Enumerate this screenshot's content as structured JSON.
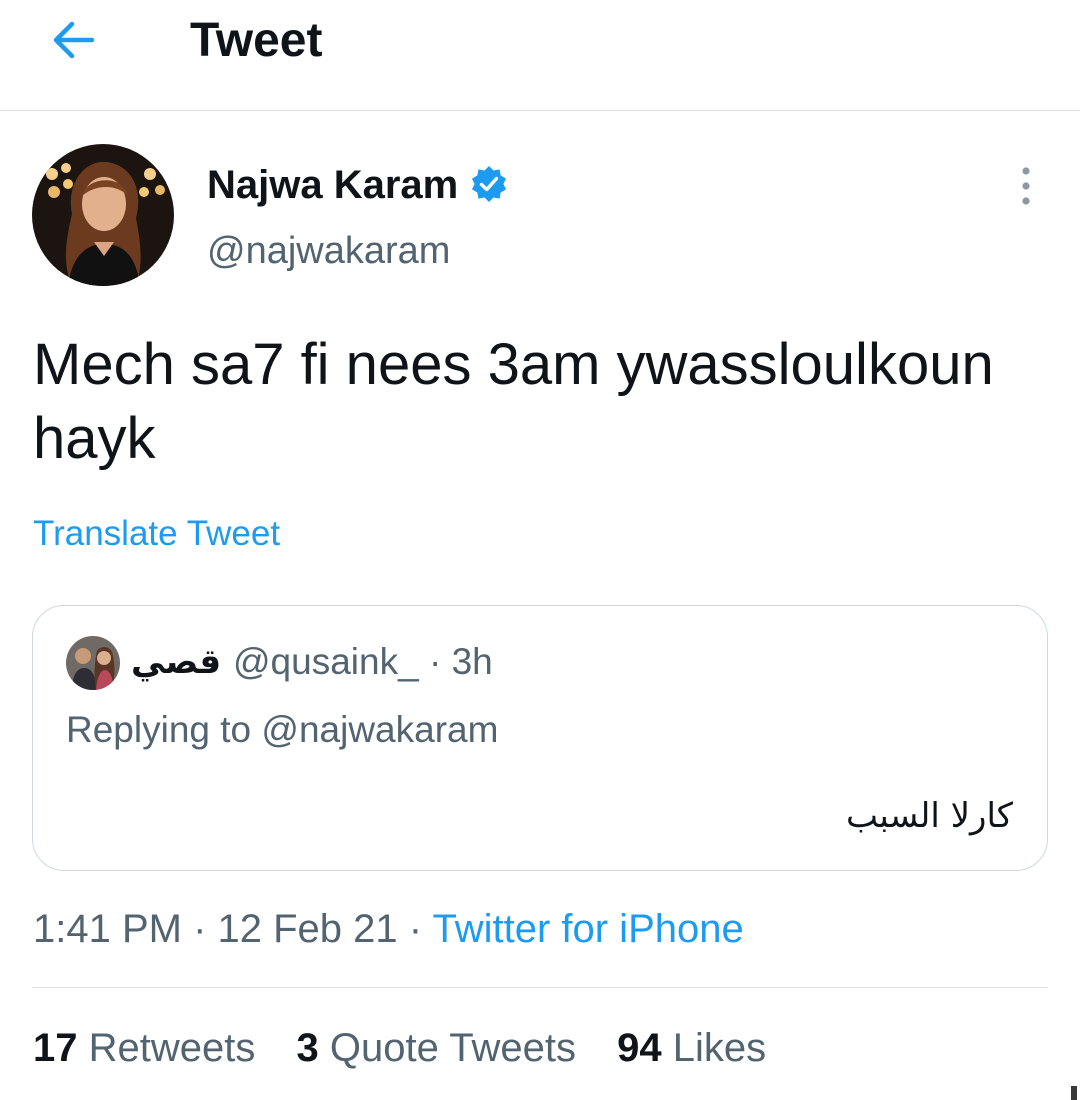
{
  "header": {
    "title": "Tweet",
    "back_icon": "arrow-left-icon"
  },
  "author": {
    "name": "Najwa Karam",
    "handle": "@najwakaram",
    "verified": true,
    "verified_color": "#1d9bf0"
  },
  "tweet": {
    "text": "Mech sa7 fi nees 3am ywassloulkoun hayk",
    "translate_label": "Translate Tweet"
  },
  "quoted": {
    "name": "قصي",
    "handle": "@qusaink_",
    "separator": "·",
    "time": "3h",
    "replying_label": "Replying to @najwakaram",
    "text": "كارلا السبب"
  },
  "meta": {
    "time": "1:41 PM",
    "date": "12 Feb 21",
    "source": "Twitter for iPhone"
  },
  "stats": [
    {
      "count": "17",
      "label": "Retweets"
    },
    {
      "count": "3",
      "label": "Quote Tweets"
    },
    {
      "count": "94",
      "label": "Likes"
    }
  ],
  "colors": {
    "accent": "#1d9bf0",
    "text_primary": "#0f1419",
    "text_secondary": "#536471",
    "border": "#cfd9de"
  }
}
